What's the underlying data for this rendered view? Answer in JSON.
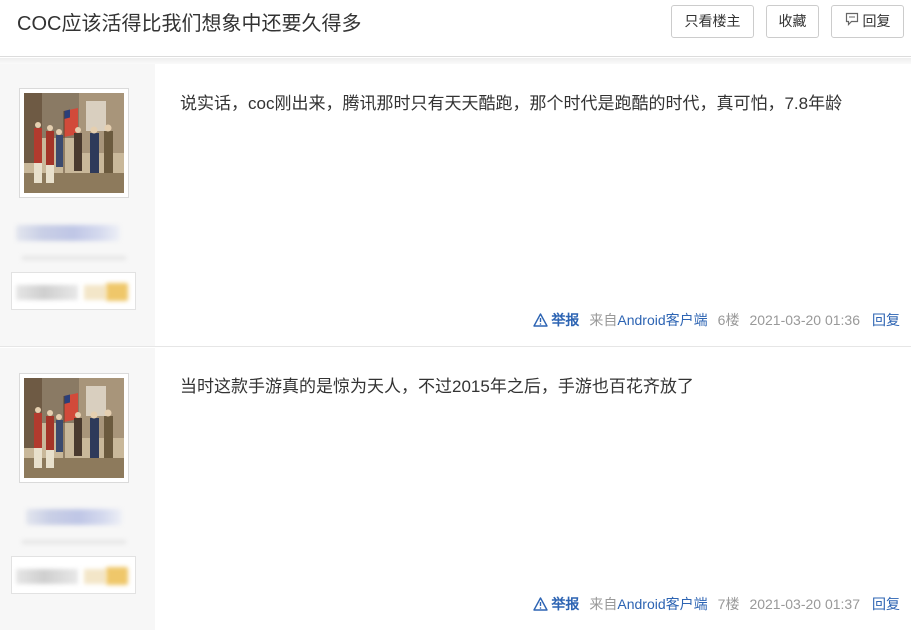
{
  "header": {
    "title": "COC应该活得比我们想象中还要久得多",
    "only_op_label": "只看楼主",
    "favorite_label": "收藏",
    "reply_label": "回复"
  },
  "posts": [
    {
      "content": "说实话，coc刚出来，腾讯那时只有天天酷跑，那个时代是跑酷的时代，真可怕，7.8年龄",
      "report_label": "举报",
      "from_prefix": "来自",
      "client": "Android客户端",
      "floor": "6楼",
      "time": "2021-03-20 01:36",
      "reply_label": "回复"
    },
    {
      "content": "当时这款手游真的是惊为天人，不过2015年之后，手游也百花齐放了",
      "report_label": "举报",
      "from_prefix": "来自",
      "client": "Android客户端",
      "floor": "7楼",
      "time": "2021-03-20 01:37",
      "reply_label": "回复"
    }
  ],
  "colors": {
    "link": "#2d64b3",
    "meta": "#999999",
    "sidebar": "#f7f7f7"
  }
}
